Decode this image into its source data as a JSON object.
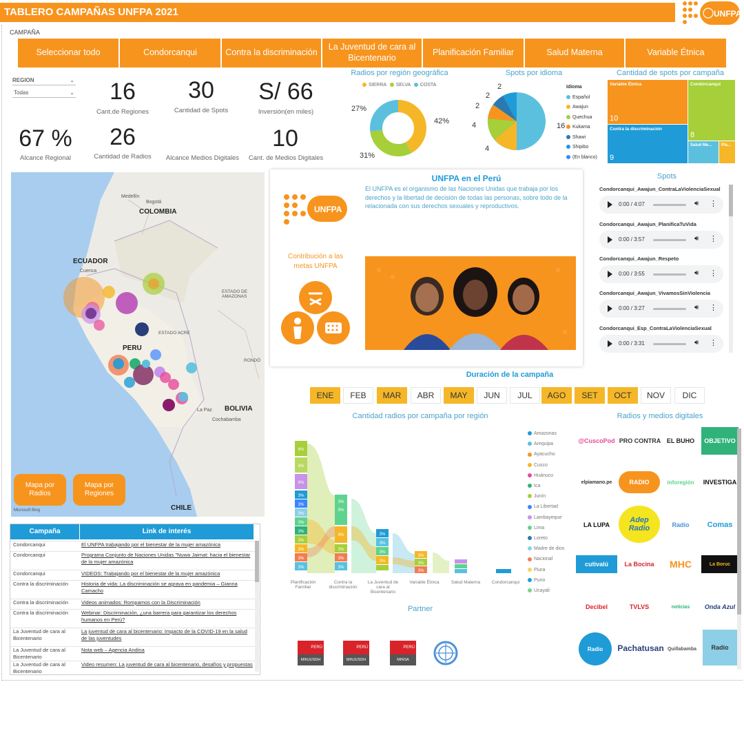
{
  "header": {
    "title": "TABLERO CAMPAÑAS UNFPA 2021",
    "logo_text": "UNFPA"
  },
  "filters": {
    "campana_label": "CAMPAÑA",
    "campaigns": [
      "Seleccionar todo",
      "Condorcanqui",
      "Contra la discriminación",
      "La Juventud de cara al Bicentenario",
      "Planificación Familiar",
      "Salud Materna",
      "Variable Étnica"
    ],
    "region_label": "REGION",
    "region_value": "Todas"
  },
  "kpis": [
    {
      "value": "16",
      "label": "Cant.de Regiones"
    },
    {
      "value": "30",
      "label": "Cantidad de Spots"
    },
    {
      "value": "S/ 66",
      "label": "Inversión(en miles)"
    },
    {
      "value": "67 %",
      "label": "Alcance Regional"
    },
    {
      "value": "26",
      "label": "Cantidad de Radios"
    },
    {
      "value": "",
      "label": "Alcance Medios Digitales"
    },
    {
      "value": "10",
      "label": "Cant. de Medios Digitales"
    }
  ],
  "donut": {
    "title": "Radios por región geográfica",
    "legend": [
      {
        "name": "SIERRA",
        "color": "#f5b727"
      },
      {
        "name": "SELVA",
        "color": "#a6cf3a"
      },
      {
        "name": "COSTA",
        "color": "#5bc0de"
      }
    ],
    "labels": [
      "27%",
      "42%",
      "31%"
    ]
  },
  "pie": {
    "title": "Spots por idioma",
    "legend_title": "Idioma",
    "legend": [
      {
        "name": "Español",
        "color": "#5bc0de"
      },
      {
        "name": "Awajun",
        "color": "#f5b727"
      },
      {
        "name": "Quechua",
        "color": "#a6cf3a"
      },
      {
        "name": "Kukama",
        "color": "#f7941d"
      },
      {
        "name": "Shawi",
        "color": "#2a7ab0"
      },
      {
        "name": "Shipibo",
        "color": "#1f9bd7"
      },
      {
        "name": "(En blanco)",
        "color": "#3a86ff"
      }
    ],
    "labels": [
      "16",
      "4",
      "4",
      "2",
      "2",
      "2"
    ]
  },
  "treemap": {
    "title": "Cantidad de spots por campaña",
    "cells": [
      {
        "name": "Variable Étnica",
        "value": "10",
        "color": "#f7941d"
      },
      {
        "name": "Condorcanqui",
        "value": "8",
        "color": "#a6cf3a"
      },
      {
        "name": "Contra la discriminación",
        "value": "9",
        "color": "#1f9bd7"
      },
      {
        "name": "Salud Me...",
        "value": "",
        "color": "#5bc0de"
      },
      {
        "name": "Pla...",
        "value": "",
        "color": "#f5b727"
      }
    ]
  },
  "map": {
    "labels": {
      "colombia": "COLOMBIA",
      "ecuador": "ECUADOR",
      "peru": "PERU",
      "bolivia": "BOLIVIA",
      "chile": "CHILE",
      "medellin": "Medellín",
      "bogota": "Bogotá",
      "cuenca": "Cuenca",
      "amazonas": "ESTADO DE AMAZONAS",
      "acre": "ESTADO ACRE",
      "rondonia": "RONDÔ",
      "lapaz": "La Paz",
      "cochabamba": "Cochabamba"
    },
    "btn_radios": "Mapa por Radios",
    "btn_regiones": "Mapa por Regiones",
    "credit": "Microsoft Bing"
  },
  "links": {
    "col1": "Campaña",
    "col2": "Link de interés",
    "rows": [
      {
        "c": "Condorcanqui",
        "l": "El UNFPA trabajando por el bienestar de la mujer amazónica"
      },
      {
        "c": "Condorcanqui",
        "l": "Programa Conjunto de Naciones Unidas \"Nuwa Jaimat: hacia el bienestar de la mujer amazónica"
      },
      {
        "c": "Condorcanqui",
        "l": "VIDEOS: Trabajando por el bienestar de la mujer amazónica"
      },
      {
        "c": "Contra la discriminación",
        "l": "Historia de vida: La discriminación se agrava en pandemia – Gianna Camacho"
      },
      {
        "c": "Contra la discriminación",
        "l": "Videos animados: Rompamos con la Discriminación"
      },
      {
        "c": "Contra la discriminación",
        "l": "Webinar: Discriminación, ¿una barrera para garantizar los derechos humanos en Perú?"
      },
      {
        "c": "La Juventud de cara al Bicentenario",
        "l": "La juventud de cara al bicentenario: Impacto de la COVID-19 en la salud de las juventudes"
      },
      {
        "c": "La Juventud de cara al Bicentenario",
        "l": "Nota web – Agencia Andina"
      },
      {
        "c": "La Juventud de cara al Bicentenario",
        "l": "Video resumen: La juventud de cara al bicentenario, desafíos y propuestas"
      }
    ]
  },
  "info": {
    "title": "UNFPA en el Perú",
    "text": "El UNFPA es el organismo de las Naciones Unidas que trabaja por los derechos y la libertad de decisión de todas las personas, sobre todo de la relacionada con sus derechos sexuales y reproductivos.",
    "contrib": "Contribución a las metas UNFPA",
    "logo_text": "UNFPA"
  },
  "spots": {
    "title": "Spots",
    "items": [
      {
        "name": "Condorcanqui_Awajun_ContraLaViolenciaSexual",
        "time": "0:00 / 4:07"
      },
      {
        "name": "Condorcanqui_Awajun_PlanificaTuVida",
        "time": "0:00 / 3:57"
      },
      {
        "name": "Condorcanqui_Awajun_Respeto",
        "time": "0:00 / 3:55"
      },
      {
        "name": "Condorcanqui_Awajun_VivamosSinViolencia",
        "time": "0:00 / 3:27"
      },
      {
        "name": "Condorcanqui_Esp_ContraLaViolenciaSexual",
        "time": "0:00 / 3:31"
      }
    ]
  },
  "duration": {
    "title": "Duración de la campaña",
    "months": [
      {
        "m": "ENE",
        "on": true
      },
      {
        "m": "FEB",
        "on": false
      },
      {
        "m": "MAR",
        "on": true
      },
      {
        "m": "ABR",
        "on": false
      },
      {
        "m": "MAY",
        "on": true
      },
      {
        "m": "JUN",
        "on": false
      },
      {
        "m": "JUL",
        "on": false
      },
      {
        "m": "AGO",
        "on": true
      },
      {
        "m": "SET",
        "on": true
      },
      {
        "m": "OCT",
        "on": true
      },
      {
        "m": "NOV",
        "on": false
      },
      {
        "m": "DIC",
        "on": false
      }
    ]
  },
  "ribbon": {
    "title": "Cantidad radios por campaña por región",
    "categories": [
      "Planificación Familiar",
      "Contra la discriminación",
      "La Juventud de cara al Bicentenario",
      "Variable Étnica",
      "Salud Materna",
      "Condorcanqui"
    ],
    "legend": [
      {
        "name": "Amazonas",
        "color": "#1f9bd7"
      },
      {
        "name": "Arequipa",
        "color": "#5bc0de"
      },
      {
        "name": "Ayacucho",
        "color": "#f7941d"
      },
      {
        "name": "Cusco",
        "color": "#f5b727"
      },
      {
        "name": "Huánuco",
        "color": "#e64a9a"
      },
      {
        "name": "Ica",
        "color": "#2fb37a"
      },
      {
        "name": "Junín",
        "color": "#a6cf3a"
      },
      {
        "name": "La Libertad",
        "color": "#3a86ff"
      },
      {
        "name": "Lambayeque",
        "color": "#c792ea"
      },
      {
        "name": "Lima",
        "color": "#5fd38d"
      },
      {
        "name": "Loreto",
        "color": "#2a7ab0"
      },
      {
        "name": "Madre de dios",
        "color": "#8ccfe6"
      },
      {
        "name": "Nacional",
        "color": "#f07d52"
      },
      {
        "name": "Piura",
        "color": "#f8d25c"
      },
      {
        "name": "Puno",
        "color": "#1f9bd7"
      },
      {
        "name": "Ucayali",
        "color": "#7bd389"
      }
    ],
    "seg_labels": [
      "6%",
      "6%",
      "6%",
      "3%",
      "3%",
      "3%",
      "3%",
      "3%",
      "3%",
      "3%",
      "3%",
      "3%",
      "3%",
      "9%",
      "9%",
      "3%",
      "3%",
      "3%",
      "3%",
      "3%",
      "3%",
      "3%",
      "3%",
      "3%",
      "3%"
    ]
  },
  "media": {
    "title": "Radios y medios digitales",
    "items": [
      "@CuscoPod",
      "PRO CONTRA",
      "EL BUHO",
      "OBJETIVO",
      "elpiamano.pe",
      "RADIO",
      "inforegión",
      "INVESTIGA",
      "LA LUPA",
      "Adep Radio",
      "Radio",
      "Comas",
      "cutivalú",
      "La Bocina",
      "MHC",
      "La Boruc",
      "Decibel",
      "TVLVS",
      "noticias",
      "Onda Azul",
      "Radio",
      "Pachatusan",
      "Quillabamba",
      "Radio"
    ]
  },
  "partner": {
    "title": "Partner",
    "items": [
      "MINJUSDH",
      "MINJUSDH",
      "MINSA"
    ],
    "flag_text": "PERÚ"
  }
}
